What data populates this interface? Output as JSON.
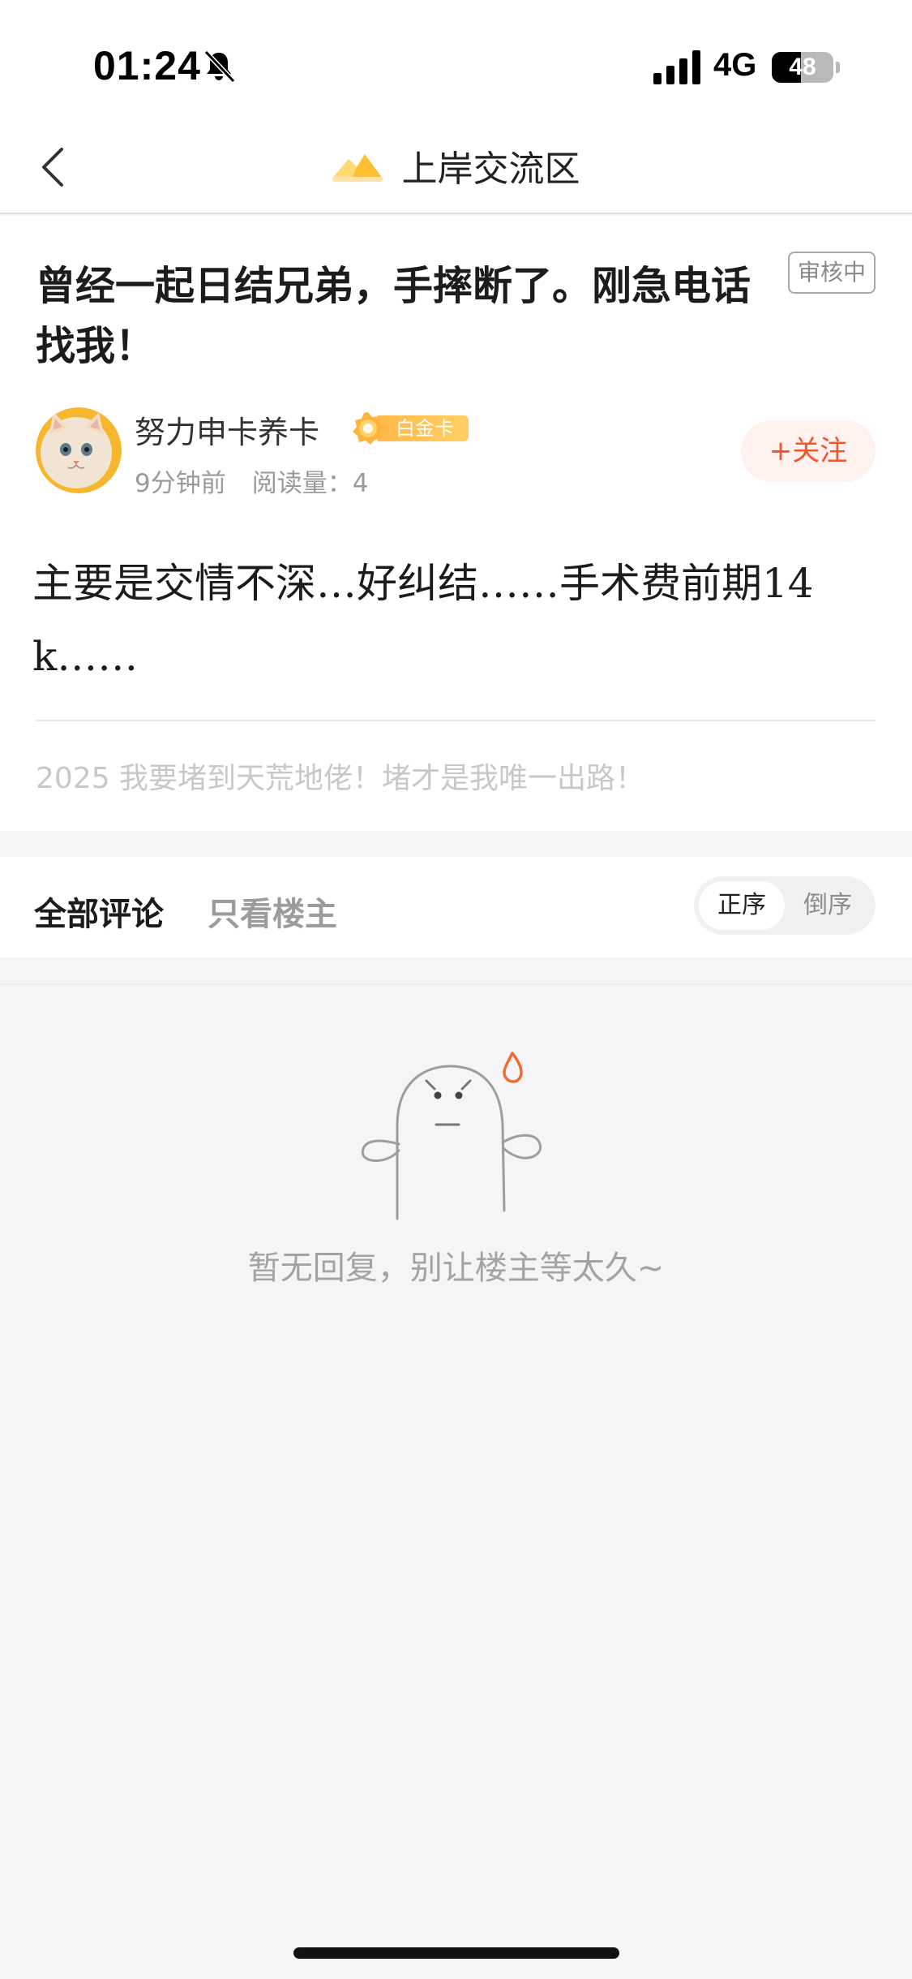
{
  "status_bar": {
    "time": "01:24",
    "network": "4G",
    "battery": "48",
    "battery_level": 0.48
  },
  "header": {
    "title": "上岸交流区"
  },
  "post": {
    "title": "曾经一起日结兄弟，手摔断了。刚急电话找我！",
    "review_badge": "审核中",
    "author": {
      "name": "努力申卡养卡",
      "badge": "白金卡"
    },
    "meta": {
      "time": "9分钟前",
      "reads": "阅读量：4"
    },
    "follow_label": "+关注",
    "body": "主要是交情不深…好纠结……手术费前期14k……",
    "signature": "2025 我要堵到天荒地佬！堵才是我唯一出路！"
  },
  "comments": {
    "tabs": [
      "全部评论",
      "只看楼主"
    ],
    "sort": [
      "正序",
      "倒序"
    ],
    "empty_text": "暂无回复，别让楼主等太久~"
  },
  "colors": {
    "accent": "#f2542d",
    "badge_gold": "#ffb84a"
  }
}
